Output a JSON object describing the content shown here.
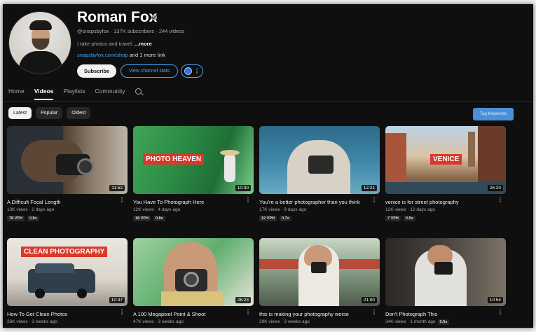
{
  "channel": {
    "name": "Roman Fox",
    "meta": "@snapsbyfox · 137K subscribers · 244 videos",
    "description": "I take photos and travel.",
    "more": "...more",
    "link": "snapsbyfox.com/shop",
    "link_suffix": "and 1 more link",
    "subscribe_label": "Subscribe",
    "stats_label": "View channel stats"
  },
  "tabs": [
    {
      "label": "Home"
    },
    {
      "label": "Videos"
    },
    {
      "label": "Playlists"
    },
    {
      "label": "Community"
    }
  ],
  "filters": {
    "latest": "Latest",
    "popular": "Popular",
    "oldest": "Oldest",
    "tag_button": "Tag Keywords"
  },
  "videos": [
    {
      "title": "A Difficult Focal Length",
      "meta": "13K views · 2 days ago",
      "duration": "11:52",
      "badge1": "78 VPH",
      "badge2": "0.8x",
      "overlay": ""
    },
    {
      "title": "You Have To Photograph Here",
      "meta": "12K views · 4 days ago",
      "duration": "10:00",
      "badge1": "18 VPH",
      "badge2": "0.8x",
      "overlay": "PHOTO HEAVEN"
    },
    {
      "title": "You're a better photographer than you think",
      "meta": "17K views · 9 days ago",
      "duration": "12:21",
      "badge1": "12 VPH",
      "badge2": "0.7x",
      "overlay": ""
    },
    {
      "title": "venice is for street photography",
      "meta": "12K views · 12 days ago",
      "duration": "26:20",
      "badge1": "7 VPH",
      "badge2": "0.5x",
      "overlay": "VENICE"
    },
    {
      "title": "How To Get Clean Photos",
      "meta": "26K views · 3 weeks ago",
      "duration": "10:47",
      "badge1": "",
      "badge2": "",
      "overlay": "CLEAN PHOTOGRAPHY"
    },
    {
      "title": "A 100 Megapixel Point & Shoot",
      "meta": "47K views · 3 weeks ago",
      "duration": "26:23",
      "badge1": "",
      "badge2": "",
      "overlay": ""
    },
    {
      "title": "this is making your photography worse",
      "meta": "29K views · 3 weeks ago",
      "duration": "21:00",
      "badge1": "",
      "badge2": "",
      "overlay": ""
    },
    {
      "title": "Don't Photograph This",
      "meta": "34K views · 1 month ago",
      "duration": "10:54",
      "badge1": "0.9x",
      "badge2": "",
      "overlay": ""
    }
  ],
  "colors": {
    "accent": "#3ea6ff",
    "overlay_red": "#d8392b",
    "background": "#0f0f0f"
  }
}
